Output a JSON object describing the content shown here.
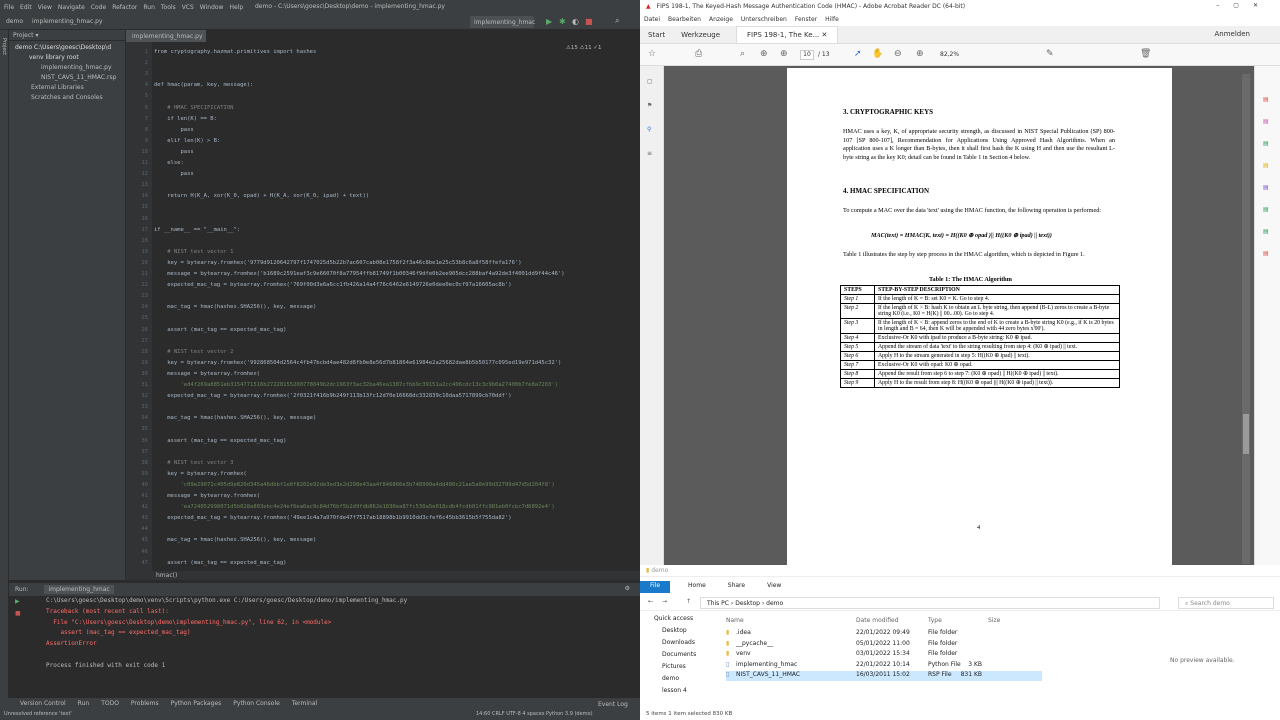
{
  "ide": {
    "menu": [
      "File",
      "Edit",
      "View",
      "Navigate",
      "Code",
      "Refactor",
      "Run",
      "Tools",
      "VCS",
      "Window",
      "Help"
    ],
    "title": "demo - C:\\Users\\goesc\\Desktop\\demo - implementing_hmac.py",
    "breadcrumb": [
      "demo",
      "implementing_hmac.py"
    ],
    "run_config": "implementing_hmac",
    "project_label": "Project",
    "tree": [
      "demo  C:\\Users\\goesc\\Desktop\\d",
      "venv  library root",
      "implementing_hmac.py",
      "NIST_CAVS_11_HMAC.rsp",
      "External Libraries",
      "Scratches and Consoles"
    ],
    "editor_tab": "implementing_hmac.py",
    "inspection": "⚠15 ⚠11 ✓1",
    "lines": [
      {
        "n": "1",
        "t": "from cryptography.hazmat.primitives import hashes"
      },
      {
        "n": "2",
        "t": ""
      },
      {
        "n": "3",
        "t": ""
      },
      {
        "n": "4",
        "t": "def hmac(param, key, message):"
      },
      {
        "n": "5",
        "t": ""
      },
      {
        "n": "6",
        "t": "    # HMAC SPECIFICATION"
      },
      {
        "n": "7",
        "t": "    if len(K) == B:"
      },
      {
        "n": "8",
        "t": "        pass"
      },
      {
        "n": "9",
        "t": "    elif len(K) > B:"
      },
      {
        "n": "10",
        "t": "        pass"
      },
      {
        "n": "11",
        "t": "    else:"
      },
      {
        "n": "12",
        "t": "        pass"
      },
      {
        "n": "13",
        "t": ""
      },
      {
        "n": "14",
        "t": "    return H(K_A, xor(K_0, opad) + H(K_A, xor(K_0, ipad) + text))"
      },
      {
        "n": "15",
        "t": ""
      },
      {
        "n": "16",
        "t": ""
      },
      {
        "n": "17",
        "t": "if __name__ == \"__main__\":"
      },
      {
        "n": "18",
        "t": ""
      },
      {
        "n": "19",
        "t": "    # NIST test vector 1"
      },
      {
        "n": "20",
        "t": "    key = bytearray.fromhex('9779d9120642797f1747025d5b22b7ac607cab08e1758f2f3a46c8be1e25c53b8c6a8f58ffefa176')"
      },
      {
        "n": "21",
        "t": "    message = bytearray.fromhex('b1689c2591eaf3c9e66070f8a77954ffb81749f1b00346f9dfe0b2ee905dcc288baf4a92de3f4001dd9f44c46')"
      },
      {
        "n": "22",
        "t": "    expected_mac_tag = bytearray.fromhex('769f00d3e6a6cc1fb426a14a4f76c6462e6149726e0dee0ec0cf97a16605ac8b')"
      },
      {
        "n": "23",
        "t": ""
      },
      {
        "n": "24",
        "t": "    mac_tag = hmac(hashes.SHA256(), key, message)"
      },
      {
        "n": "25",
        "t": ""
      },
      {
        "n": "26",
        "t": "    assert (mac_tag == expected_mac_tag)"
      },
      {
        "n": "27",
        "t": ""
      },
      {
        "n": "28",
        "t": "    # NIST test vector 2"
      },
      {
        "n": "29",
        "t": "    key = bytearray.fromhex('992868504d2564c4fb47bcbd4ae482d8fb0e8e56d7b81864e61984e2a25682dae8b5b50177c095ed19e971d45c32')"
      },
      {
        "n": "30",
        "t": "    message = bytearray.fromhex("
      },
      {
        "n": "31",
        "t": "        'ed4f269a8851eb3154771516b27228155200778049b2dc1963f3ac32ba46ea1387cfbb9c39151a2cc406cdc13c3c9b0a27400b7fe8a7203')"
      },
      {
        "n": "32",
        "t": "    expected_mac_tag = bytearray.fromhex('2f0321f416b9b249f113b13fc12d70e16668dc332839c10daa5717899cb70ddf')"
      },
      {
        "n": "33",
        "t": ""
      },
      {
        "n": "34",
        "t": "    mac_tag = hmac(hashes.SHA256(), key, message)"
      },
      {
        "n": "35",
        "t": ""
      },
      {
        "n": "36",
        "t": "    assert (mac_tag == expected_mac_tag)"
      },
      {
        "n": "37",
        "t": ""
      },
      {
        "n": "38",
        "t": "    # NIST test vector 3"
      },
      {
        "n": "39",
        "t": "    key = bytearray.fromhex("
      },
      {
        "n": "40",
        "t": "        'c09e29071c405d9e820d345a46dbbf1e0f8202e92de3ed3e2d298e43aa4f846866e3b748990a4dd480c21ae5a0e99d32799d47d5d204f8')"
      },
      {
        "n": "41",
        "t": "    message = bytearray.fromhex("
      },
      {
        "n": "42",
        "t": "        'ea724052998071d5b028a803ebc4e24ef6ea0ac9c84d76bf5b2d9fdb862e1030ea87fc530a5e018cdb4fcdb01ffc981eb0fcbc7d6892e4')"
      },
      {
        "n": "43",
        "t": "    expected_mac_tag = bytearray.fromhex('49ee1c4a7a970fde47f7517ab18898b1b9910dd3cfef6c45bb3615b5f755da82')"
      },
      {
        "n": "44",
        "t": ""
      },
      {
        "n": "45",
        "t": "    mac_tag = hmac(hashes.SHA256(), key, message)"
      },
      {
        "n": "46",
        "t": ""
      },
      {
        "n": "47",
        "t": "    assert (mac_tag == expected_mac_tag)"
      }
    ],
    "crumb_bottom": "hmac()",
    "run": {
      "tab": "Run:",
      "config": "implementing_hmac",
      "output": [
        "C:\\Users\\goesc\\Desktop\\demo\\venv\\Scripts\\python.exe C:/Users/goesc/Desktop/demo/implementing_hmac.py",
        "Traceback (most recent call last):",
        "  File \"C:\\Users\\goesc\\Desktop\\demo\\implementing_hmac.py\", line 62, in <module>",
        "    assert (mac_tag == expected_mac_tag)",
        "AssertionError",
        "",
        "Process finished with exit code 1"
      ]
    },
    "bottom_tabs": [
      "Version Control",
      "Run",
      "TODO",
      "Problems",
      "Python Packages",
      "Python Console",
      "Terminal"
    ],
    "event_log": "Event Log",
    "status_left": "Unresolved reference 'text'",
    "status_right": "14:60  CRLF  UTF-8  4 spaces  Python 3.9 (demo)"
  },
  "acrobat": {
    "title": "FIPS 198-1, The Keyed-Hash Message Authentication Code (HMAC) - Adobe Acrobat Reader DC (64-bit)",
    "menu": [
      "Datei",
      "Bearbeiten",
      "Anzeige",
      "Unterschreiben",
      "Fenster",
      "Hilfe"
    ],
    "tabs": [
      "Start",
      "Werkzeuge",
      "FIPS 198-1, The Ke..."
    ],
    "signin": "Anmelden",
    "page_current": "10",
    "page_total": "/ 13",
    "zoom": "82,2%",
    "page": {
      "h3": "3.        CRYPTOGRAPHIC KEYS",
      "p3": "HMAC uses a key, K, of appropriate security strength, as discussed in NIST Special Publication (SP) 800-107 [SP 800-107], Recommendation for Applications Using Approved Hash Algorithms. When an application uses a K longer than B-bytes, then it shall first hash the K using H and then use the resultant L-byte string as the key K0; detail can be found in Table 1 in Section 4 below.",
      "h4": "4.        HMAC SPECIFICATION",
      "p4": "To compute a MAC over the data 'text' using the HMAC function, the following operation is performed:",
      "formula": "MAC(text) = HMAC(K, text) = H((K0 ⊕ opad )|| H((K0 ⊕ ipad) || text))",
      "p5": "Table 1 illustrates the step by step process in the HMAC algorithm, which is depicted in Figure 1.",
      "table_title": "Table 1: The HMAC Algorithm",
      "col1": "STEPS",
      "col2": "STEP-BY-STEP DESCRIPTION",
      "rows": [
        {
          "s": "Step 1",
          "d": "If the length of K = B: set K0 = K. Go to step 4."
        },
        {
          "s": "Step 2",
          "d": "If the length of K > B: hash K to obtain an L byte string, then append (B-L) zeros to create a B-byte string K0 (i.e., K0 = H(K) || 00...00). Go to step 4."
        },
        {
          "s": "Step 3",
          "d": "If the length of K < B: append zeros to the end of K to create a B-byte string K0 (e.g., if K is 20 bytes in length and B = 64, then K will be appended with 44 zero bytes x'00')."
        },
        {
          "s": "Step 4",
          "d": "Exclusive-Or K0 with ipad to produce a B-byte string: K0 ⊕ ipad."
        },
        {
          "s": "Step 5",
          "d": "Append the stream of data 'text' to the string resulting from step 4: (K0 ⊕ ipad) || text."
        },
        {
          "s": "Step 6",
          "d": "Apply H to the stream generated in step 5: H((K0 ⊕ ipad) || text)."
        },
        {
          "s": "Step 7",
          "d": "Exclusive-Or K0 with opad: K0 ⊕ opad."
        },
        {
          "s": "Step 8",
          "d": "Append the result from step 6 to step 7: (K0 ⊕ opad) || H((K0 ⊕ ipad) || text)."
        },
        {
          "s": "Step 9",
          "d": "Apply H to the result from step 8: H((K0 ⊕ opad )|| H((K0 ⊕ ipad) || text))."
        }
      ],
      "page_number": "4"
    }
  },
  "explorer": {
    "title": "demo",
    "ribbon": [
      "File",
      "Home",
      "Share",
      "View"
    ],
    "path": [
      "This PC",
      "Desktop",
      "demo"
    ],
    "search_placeholder": "Search demo",
    "nav": [
      "Quick access",
      "Desktop",
      "Downloads",
      "Documents",
      "Pictures",
      "demo",
      "lesson 4"
    ],
    "columns": [
      "Name",
      "Date modified",
      "Type",
      "Size"
    ],
    "files": [
      {
        "name": ".idea",
        "date": "22/01/2022 09:49",
        "type": "File folder",
        "size": ""
      },
      {
        "name": "__pycache__",
        "date": "05/01/2022 11:00",
        "type": "File folder",
        "size": ""
      },
      {
        "name": "venv",
        "date": "03/01/2022 15:34",
        "type": "File folder",
        "size": ""
      },
      {
        "name": "implementing_hmac",
        "date": "22/01/2022 10:14",
        "type": "Python File",
        "size": "3 KB"
      },
      {
        "name": "NIST_CAVS_11_HMAC",
        "date": "16/03/2011 15:02",
        "type": "RSP File",
        "size": "831 KB"
      }
    ],
    "preview": "No preview available.",
    "status": "5 items    1 item selected  830 KB"
  }
}
